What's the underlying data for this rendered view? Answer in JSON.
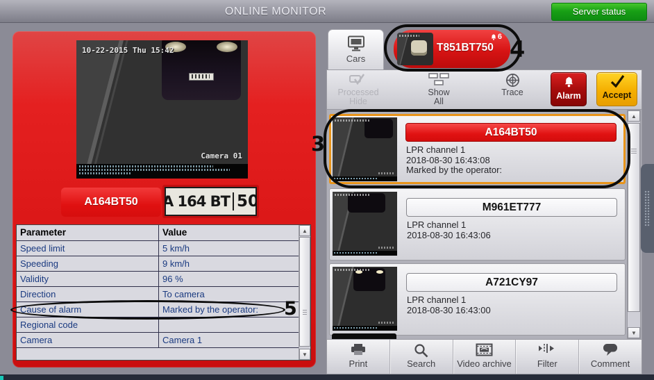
{
  "header": {
    "title": "ONLINE MONITOR",
    "server_status": "Server status"
  },
  "annotations": {
    "item_callout": "3",
    "widget_callout": "4",
    "row_callout": "5"
  },
  "left_panel": {
    "camera_view": {
      "timestamp": "10-22-2015 Thu 15:42",
      "camera_label": "Camera 01"
    },
    "plate_text": "A164BT50",
    "plate_image": {
      "main": "A 164 BT",
      "region": "50"
    },
    "table": {
      "header_parameter": "Parameter",
      "header_value": "Value",
      "rows": [
        {
          "parameter": "Speed limit",
          "value": "5 km/h"
        },
        {
          "parameter": "Speeding",
          "value": "9 km/h"
        },
        {
          "parameter": "Validity",
          "value": "96 %"
        },
        {
          "parameter": "Direction",
          "value": "To camera"
        },
        {
          "parameter": "Cause of alarm",
          "value": "Marked by the operator:"
        },
        {
          "parameter": "Regional code",
          "value": ""
        },
        {
          "parameter": "Camera",
          "value": "Camera 1"
        }
      ]
    }
  },
  "right_panel": {
    "cars_tab_label": "Cars",
    "alert_widget": {
      "plate": "T851BT750",
      "badge": "6"
    },
    "toolbar": {
      "processed_line1": "Processed",
      "processed_line2": "Hide",
      "show_all_line1": "Show",
      "show_all_line2": "All",
      "trace": "Trace",
      "alarm": "Alarm",
      "accept": "Accept"
    },
    "events": [
      {
        "plate": "A164BT50",
        "channel": "LPR channel 1",
        "time": "2018-08-30 16:43:08",
        "note": "Marked by the operator:"
      },
      {
        "plate": "M961ET777",
        "channel": "LPR channel 1",
        "time": "2018-08-30 16:43:06",
        "note": ""
      },
      {
        "plate": "A721CY97",
        "channel": "LPR channel 1",
        "time": "2018-08-30 16:43:00",
        "note": ""
      }
    ],
    "bottom_toolbar": [
      {
        "label": "Print",
        "icon": "print-icon"
      },
      {
        "label": "Search",
        "icon": "search-icon"
      },
      {
        "label": "Video archive",
        "icon": "video-archive-icon"
      },
      {
        "label": "Filter",
        "icon": "filter-icon"
      },
      {
        "label": "Comment",
        "icon": "comment-icon"
      }
    ]
  },
  "colors": {
    "alarm_red": "#a30b0b",
    "accept_amber": "#f4ae00",
    "server_green": "#18a015",
    "panel_red": "#d51111",
    "highlight_orange": "#e8941a",
    "table_text_navy": "#1a3a80"
  }
}
